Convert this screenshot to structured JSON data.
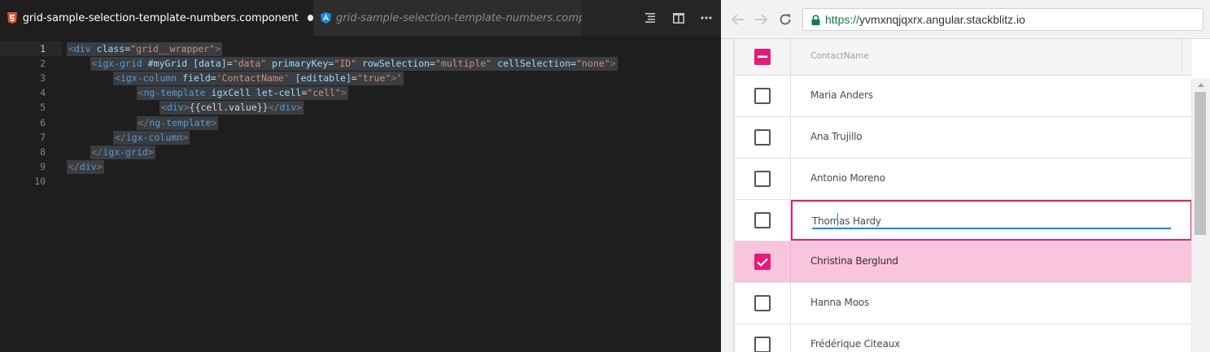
{
  "editor": {
    "tabs": [
      {
        "label": "grid-sample-selection-template-numbers.component.html",
        "icon": "html5-icon",
        "active": true,
        "dirty": true
      },
      {
        "label": "grid-sample-selection-template-numbers.component.ts",
        "icon": "angular-icon",
        "active": false
      }
    ],
    "actions": [
      "outline-icon",
      "split-editor-icon",
      "more-icon"
    ],
    "lines": [
      {
        "n": "1",
        "indent": 0,
        "tokens": [
          [
            "tg",
            "<"
          ],
          [
            "tn",
            "div"
          ],
          [
            "tx",
            " "
          ],
          [
            "an",
            "class"
          ],
          [
            "tx",
            "="
          ],
          [
            "av",
            "\"grid__wrapper\""
          ],
          [
            "tg",
            ">"
          ]
        ]
      },
      {
        "n": "2",
        "indent": 1,
        "tokens": [
          [
            "tg",
            "<"
          ],
          [
            "tn",
            "igx-grid"
          ],
          [
            "tx",
            " "
          ],
          [
            "an",
            "#myGrid [data]"
          ],
          [
            "tx",
            "="
          ],
          [
            "av",
            "\"data\""
          ],
          [
            "tx",
            " "
          ],
          [
            "an",
            "primaryKey"
          ],
          [
            "tx",
            "="
          ],
          [
            "av",
            "\"ID\""
          ],
          [
            "tx",
            " "
          ],
          [
            "an",
            "rowSelection"
          ],
          [
            "tx",
            "="
          ],
          [
            "av",
            "\"multiple\""
          ],
          [
            "tx",
            " "
          ],
          [
            "an",
            "cellSelection"
          ],
          [
            "tx",
            "="
          ],
          [
            "av",
            "\"none\""
          ],
          [
            "tg",
            ">"
          ]
        ]
      },
      {
        "n": "3",
        "indent": 2,
        "tokens": [
          [
            "tg",
            "<"
          ],
          [
            "tn",
            "igx-column"
          ],
          [
            "tx",
            " "
          ],
          [
            "an",
            "field"
          ],
          [
            "tx",
            "="
          ],
          [
            "av",
            "'ContactName'"
          ],
          [
            "tx",
            " "
          ],
          [
            "an",
            "[editable]"
          ],
          [
            "tx",
            "="
          ],
          [
            "av",
            "\"true\""
          ],
          [
            "tg",
            ">"
          ],
          [
            "av",
            "'"
          ]
        ]
      },
      {
        "n": "4",
        "indent": 3,
        "tokens": [
          [
            "tg",
            "<"
          ],
          [
            "tn",
            "ng-template"
          ],
          [
            "tx",
            " "
          ],
          [
            "an",
            "igxCell let-cell"
          ],
          [
            "tx",
            "="
          ],
          [
            "av",
            "\"cell\""
          ],
          [
            "tg",
            ">"
          ]
        ]
      },
      {
        "n": "5",
        "indent": 4,
        "tokens": [
          [
            "tg",
            "<"
          ],
          [
            "tn",
            "div"
          ],
          [
            "tg",
            ">"
          ],
          [
            "tx",
            "{{cell.value}}"
          ],
          [
            "tg",
            "</"
          ],
          [
            "tn",
            "div"
          ],
          [
            "tg",
            ">"
          ]
        ]
      },
      {
        "n": "6",
        "indent": 3,
        "tokens": [
          [
            "tg",
            "</"
          ],
          [
            "tn",
            "ng-template"
          ],
          [
            "tg",
            ">"
          ]
        ]
      },
      {
        "n": "7",
        "indent": 2,
        "tokens": [
          [
            "tg",
            "</"
          ],
          [
            "tn",
            "igx-column"
          ],
          [
            "tg",
            ">"
          ]
        ]
      },
      {
        "n": "8",
        "indent": 1,
        "tokens": [
          [
            "tg",
            "</"
          ],
          [
            "tn",
            "igx-grid"
          ],
          [
            "tg",
            ">"
          ]
        ]
      },
      {
        "n": "9",
        "indent": 0,
        "tokens": [
          [
            "tg",
            "</"
          ],
          [
            "tn",
            "div"
          ],
          [
            "tg",
            ">"
          ]
        ]
      },
      {
        "n": "10",
        "indent": 0,
        "tokens": []
      }
    ]
  },
  "browser": {
    "url_scheme": "https://",
    "url_rest": "yvmxnqjqxrx.angular.stackblitz.io",
    "grid": {
      "column_header": "ContactName",
      "header_checkbox_state": "indeterminate",
      "rows": [
        {
          "name": "Maria Anders",
          "selected": false,
          "editing": false
        },
        {
          "name": "Ana Trujillo",
          "selected": false,
          "editing": false
        },
        {
          "name": "Antonio Moreno",
          "selected": false,
          "editing": false
        },
        {
          "name": "Thomas Hardy",
          "selected": false,
          "editing": true
        },
        {
          "name": "Christina Berglund",
          "selected": true,
          "editing": false
        },
        {
          "name": "Hanna Moos",
          "selected": false,
          "editing": false
        },
        {
          "name": "Frédérique Citeaux",
          "selected": false,
          "editing": false
        }
      ]
    }
  },
  "colors": {
    "accent": "#e41c77",
    "selected_row": "#f8c5dd",
    "edit_underline": "#1a87e4",
    "secure_url": "#0b8043"
  }
}
